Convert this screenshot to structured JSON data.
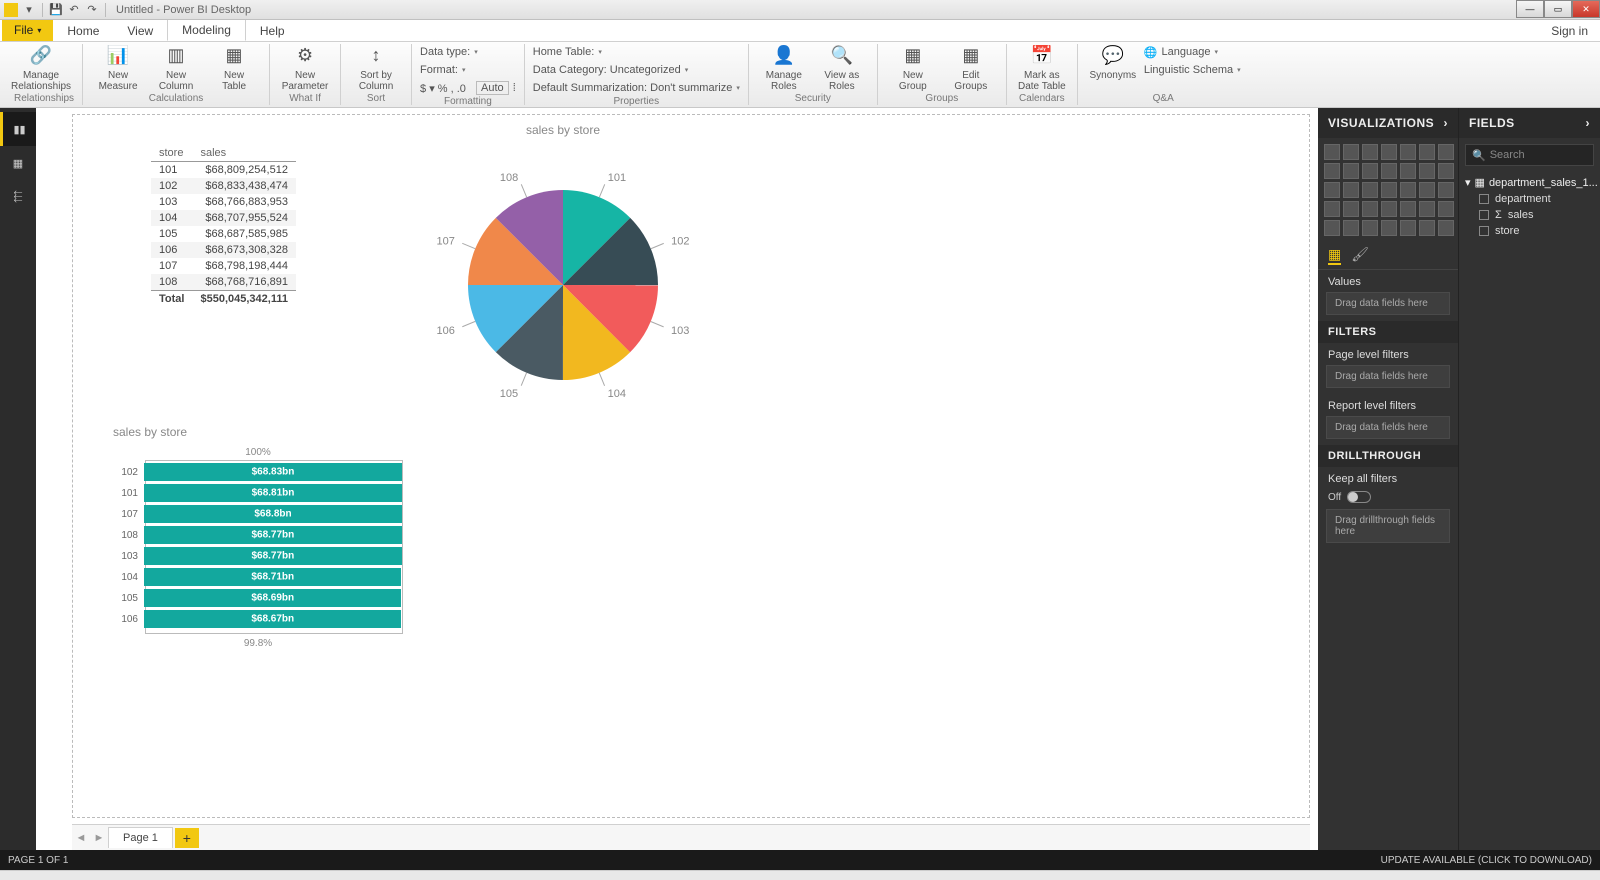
{
  "window": {
    "title": "Untitled - Power BI Desktop",
    "signin": "Sign in"
  },
  "menutabs": {
    "file": "File",
    "items": [
      "Home",
      "View",
      "Modeling",
      "Help"
    ],
    "active": 2
  },
  "ribbon": {
    "groups": {
      "relationships": {
        "label": "Relationships",
        "btn": "Manage\nRelationships"
      },
      "calculations": {
        "label": "Calculations",
        "b1": "New\nMeasure",
        "b2": "New\nColumn",
        "b3": "New\nTable"
      },
      "whatif": {
        "label": "What If",
        "btn": "New\nParameter"
      },
      "sort": {
        "label": "Sort",
        "btn": "Sort by\nColumn"
      },
      "formatting": {
        "label": "Formatting",
        "datatype": "Data type:",
        "format": "Format:",
        "auto": "Auto"
      },
      "properties": {
        "label": "Properties",
        "hometable": "Home Table:",
        "datacat": "Data Category: Uncategorized",
        "defsum": "Default Summarization: Don't summarize"
      },
      "security": {
        "label": "Security",
        "b1": "Manage\nRoles",
        "b2": "View as\nRoles"
      },
      "groups": {
        "label": "Groups",
        "b1": "New\nGroup",
        "b2": "Edit\nGroups"
      },
      "calendars": {
        "label": "Calendars",
        "btn": "Mark as\nDate Table"
      },
      "qa": {
        "label": "Q&A",
        "btn": "Synonyms",
        "lang": "Language",
        "schema": "Linguistic Schema"
      }
    }
  },
  "canvas": {
    "table": {
      "headers": [
        "store",
        "sales"
      ],
      "rows": [
        [
          "101",
          "$68,809,254,512"
        ],
        [
          "102",
          "$68,833,438,474"
        ],
        [
          "103",
          "$68,766,883,953"
        ],
        [
          "104",
          "$68,707,955,524"
        ],
        [
          "105",
          "$68,687,585,985"
        ],
        [
          "106",
          "$68,673,308,328"
        ],
        [
          "107",
          "$68,798,198,444"
        ],
        [
          "108",
          "$68,768,716,891"
        ]
      ],
      "total": [
        "Total",
        "$550,045,342,111"
      ]
    },
    "pie_title": "sales by store",
    "bar_title": "sales by store",
    "bar_top": "100%",
    "bar_bot": "99.8%"
  },
  "chart_data": [
    {
      "type": "pie",
      "title": "sales by store",
      "categories": [
        "101",
        "102",
        "103",
        "104",
        "105",
        "106",
        "107",
        "108"
      ],
      "values": [
        68809254512,
        68833438474,
        68766883953,
        68707955524,
        68687585985,
        68673308328,
        68798198444,
        68768716891
      ],
      "colors": [
        "#16b5a5",
        "#374c55",
        "#f25b5b",
        "#f2b81f",
        "#4a5a63",
        "#4bb9e6",
        "#f0884a",
        "#9460a8"
      ]
    },
    {
      "type": "bar",
      "title": "sales by store",
      "orientation": "horizontal",
      "categories": [
        "102",
        "101",
        "107",
        "108",
        "103",
        "104",
        "105",
        "106"
      ],
      "values": [
        68.83,
        68.81,
        68.8,
        68.77,
        68.77,
        68.71,
        68.69,
        68.67
      ],
      "value_labels": [
        "$68.83bn",
        "$68.81bn",
        "$68.8bn",
        "$68.77bn",
        "$68.77bn",
        "$68.71bn",
        "$68.69bn",
        "$68.67bn"
      ],
      "xlim": [
        0,
        100
      ],
      "xlabel_top": "100%",
      "xlabel_bottom": "99.8%"
    }
  ],
  "pagetabs": {
    "page": "Page 1"
  },
  "viz": {
    "header": "VISUALIZATIONS",
    "values": "Values",
    "dragfields": "Drag data fields here",
    "filters": "FILTERS",
    "pagefilters": "Page level filters",
    "reportfilters": "Report level filters",
    "drill": "DRILLTHROUGH",
    "keepall": "Keep all filters",
    "off": "Off",
    "dragdrill": "Drag drillthrough fields here"
  },
  "fields": {
    "header": "FIELDS",
    "search": "Search",
    "table": "department_sales_1...",
    "cols": [
      "department",
      "sales",
      "store"
    ]
  },
  "status": {
    "left": "PAGE 1 OF 1",
    "right": "UPDATE AVAILABLE (CLICK TO DOWNLOAD)"
  }
}
